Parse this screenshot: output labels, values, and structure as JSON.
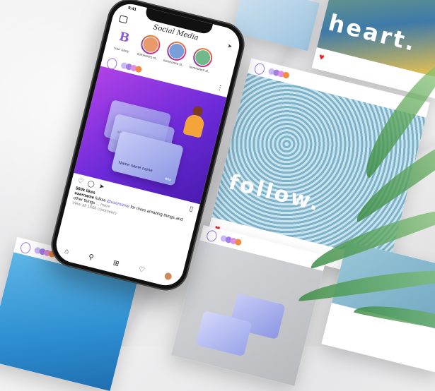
{
  "phone": {
    "time": "9:41",
    "app_title": "Social Media",
    "stories": [
      {
        "label": "Your Story"
      },
      {
        "label": "someones st.."
      },
      {
        "label": "someones st.."
      },
      {
        "label": "someones st.."
      }
    ],
    "card_name": "Name name name",
    "card_number": "0000 0000 0000 0000",
    "card_brand": "VISA",
    "likes": "560k likes",
    "caption_user": "username",
    "caption_rest": " follow ",
    "caption_handle": "@username",
    "caption_tail": " for more amazing things and other things",
    "more": "... more",
    "view_comments": "View all 160k comments"
  },
  "cards": {
    "heart_word": "heart.",
    "follow_word": "follow."
  },
  "colors": {
    "accent_purple": "#8a5cdc",
    "post_gradient_start": "#b042e8",
    "post_gradient_end": "#4a1bb0",
    "heart_red": "#e0262f",
    "rope_blue": "#8fc2d6"
  }
}
